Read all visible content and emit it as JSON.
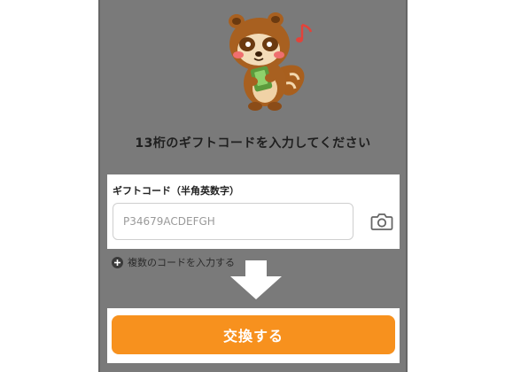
{
  "headline": "13桁のギフトコードを入力してください",
  "code_field": {
    "label": "ギフトコード（半角英数字）",
    "placeholder": "P34679ACDEFGH",
    "value": ""
  },
  "camera": {
    "icon": "camera-icon"
  },
  "multi_code_link": {
    "icon": "plus-circle-icon",
    "label": "複数のコードを入力する"
  },
  "submit": {
    "label": "交換する"
  },
  "colors": {
    "overlay": "#7a7a7a",
    "accent": "#f7911e",
    "panel": "#ffffff"
  }
}
